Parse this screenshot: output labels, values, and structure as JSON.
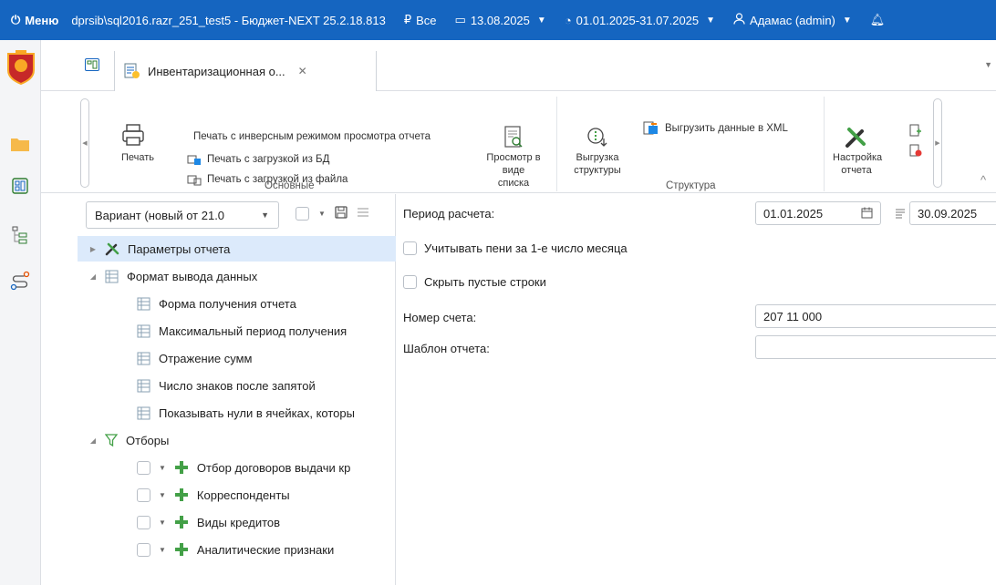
{
  "titlebar": {
    "menu_label": "Меню",
    "connection": "dprsib\\sql2016.razr_251_test5 - Бюджет-NEXT 25.2.18.813",
    "currency_filter": "Все",
    "date": "13.08.2025",
    "period": "01.01.2025-31.07.2025",
    "user": "Адамас (admin)"
  },
  "tabs": {
    "doc_tab_label": "Инвентаризационная о..."
  },
  "ribbon": {
    "print_label": "Печать",
    "print_inverse": "Печать с инверсным режимом просмотра отчета",
    "print_db": "Печать с загрузкой из БД",
    "print_file": "Печать с загрузкой из файла",
    "list_view_line1": "Просмотр в",
    "list_view_line2": "виде списка",
    "group_main": "Основные",
    "export_structure_line1": "Выгрузка",
    "export_structure_line2": "структуры",
    "export_xml": "Выгрузить данные в XML",
    "group_structure": "Структура",
    "report_settings_line1": "Настройка",
    "report_settings_line2": "отчета"
  },
  "left": {
    "variant_value": "Вариант (новый от 21.0"
  },
  "tree": [
    {
      "label": "Параметры отчета"
    },
    {
      "label": "Формат вывода данных"
    },
    {
      "label": "Форма получения отчета"
    },
    {
      "label": "Максимальный период получения"
    },
    {
      "label": "Отражение сумм"
    },
    {
      "label": "Число знаков после запятой"
    },
    {
      "label": "Показывать нули в ячейках, которы"
    },
    {
      "label": "Отборы"
    },
    {
      "label": "Отбор договоров выдачи кр"
    },
    {
      "label": "Корреспонденты"
    },
    {
      "label": "Виды кредитов"
    },
    {
      "label": "Аналитические признаки"
    }
  ],
  "form": {
    "period_label": "Период расчета:",
    "period_from": "01.01.2025",
    "period_to": "30.09.2025",
    "penalty_label": "Учитывать пени за 1-е число месяца",
    "hide_empty_label": "Скрыть пустые строки",
    "account_label": "Номер счета:",
    "account_value": "207 11 000",
    "template_label": "Шаблон отчета:",
    "template_value": ""
  },
  "colors": {
    "titlebar_bg": "#1565c0",
    "selection_bg": "#dceafb",
    "accent_green": "#43a047"
  }
}
